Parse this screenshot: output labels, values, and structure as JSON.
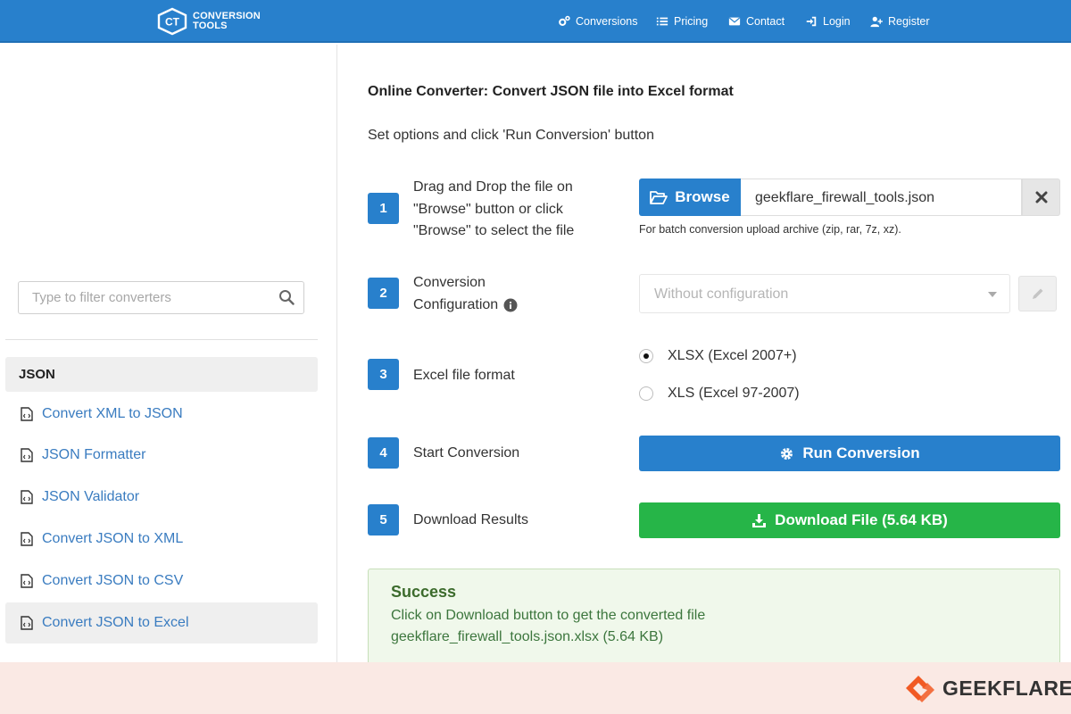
{
  "brand": {
    "line1": "CONVERSION",
    "line2": "TOOLS",
    "badge": "CT"
  },
  "nav": [
    {
      "label": "Conversions",
      "icon": "cogs-icon"
    },
    {
      "label": "Pricing",
      "icon": "list-icon"
    },
    {
      "label": "Contact",
      "icon": "envelope-icon"
    },
    {
      "label": "Login",
      "icon": "sign-in-icon"
    },
    {
      "label": "Register",
      "icon": "user-plus-icon"
    }
  ],
  "sidebar": {
    "filter_placeholder": "Type to filter converters",
    "category": "JSON",
    "items": [
      {
        "label": "Convert XML to JSON"
      },
      {
        "label": "JSON Formatter"
      },
      {
        "label": "JSON Validator"
      },
      {
        "label": "Convert JSON to XML"
      },
      {
        "label": "Convert JSON to CSV"
      },
      {
        "label": "Convert JSON to Excel",
        "active": true
      }
    ]
  },
  "main": {
    "title": "Online Converter: Convert JSON file into Excel format",
    "subtitle": "Set options and click 'Run Conversion' button",
    "steps": [
      {
        "num": "1",
        "lines": [
          "Drag and Drop the file on",
          "\"Browse\" button or click",
          "\"Browse\" to select the file"
        ]
      },
      {
        "num": "2",
        "lines": [
          "Conversion",
          "Configuration"
        ]
      },
      {
        "num": "3",
        "lines": [
          "Excel file format"
        ]
      },
      {
        "num": "4",
        "lines": [
          "Start Conversion"
        ]
      },
      {
        "num": "5",
        "lines": [
          "Download Results"
        ]
      }
    ],
    "browse_label": "Browse",
    "file_name": "geekflare_firewall_tools.json",
    "batch_hint": "For batch conversion upload archive (zip, rar, 7z, xz).",
    "config_value": "Without configuration",
    "formats": [
      {
        "label": "XLSX (Excel 2007+)",
        "checked": true
      },
      {
        "label": "XLS (Excel 97-2007)",
        "checked": false
      }
    ],
    "run_label": "Run Conversion",
    "download_label": "Download File (5.64 KB)",
    "alert": {
      "heading": "Success",
      "line1": "Click on Download button to get the converted file",
      "line2": "geekflare_firewall_tools.json.xlsx (5.64 KB)"
    }
  },
  "watermark": "GEEKFLARE",
  "colors": {
    "primary": "#2880cc",
    "success": "#26b548",
    "link": "#3a7cc0",
    "alert_bg": "#f0f8eb"
  }
}
